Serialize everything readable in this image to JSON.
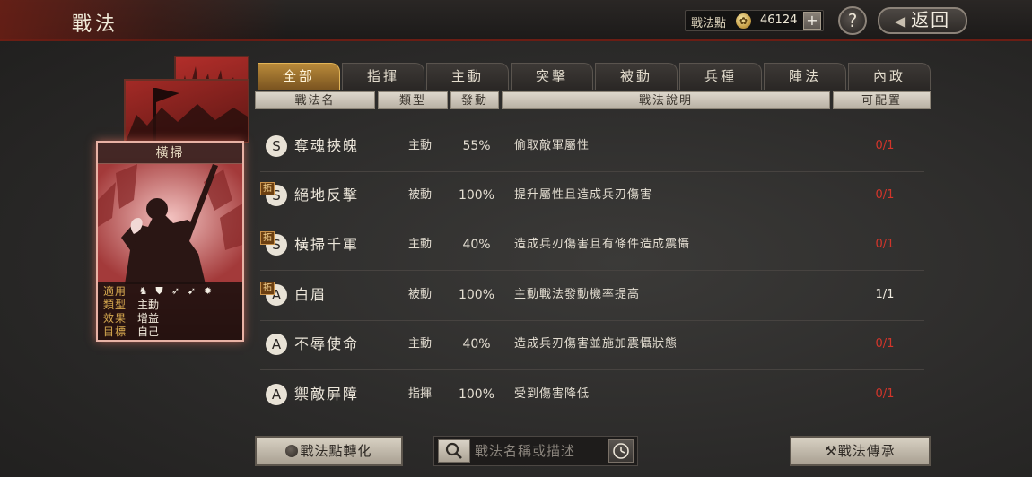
{
  "header": {
    "title": "戰法",
    "points_label": "戰法點",
    "points_value": "46124",
    "plus_label": "+",
    "help_label": "?",
    "back_label": "返回"
  },
  "card": {
    "name": "橫掃",
    "rows": [
      {
        "key": "適用",
        "value": ""
      },
      {
        "key": "類型",
        "value": "主動"
      },
      {
        "key": "效果",
        "value": "增益"
      },
      {
        "key": "目標",
        "value": "自己"
      }
    ],
    "troop_icons": [
      "cavalry-icon",
      "shield-icon",
      "bow-icon",
      "spear-icon",
      "wheel-icon"
    ]
  },
  "tabs": [
    "全部",
    "指揮",
    "主動",
    "突擊",
    "被動",
    "兵種",
    "陣法",
    "內政"
  ],
  "active_tab": 0,
  "columns": [
    "戰法名",
    "類型",
    "發動",
    "戰法說明",
    "可配置"
  ],
  "rows": [
    {
      "grade": "S",
      "tag": "",
      "name": "奪魂挾魄",
      "type": "主動",
      "rate": "55%",
      "desc": "偷取敵軍屬性",
      "slots": "0/1",
      "slot_color": "red"
    },
    {
      "grade": "S",
      "tag": "拓",
      "name": "絕地反擊",
      "type": "被動",
      "rate": "100%",
      "desc": "提升屬性且造成兵刃傷害",
      "slots": "0/1",
      "slot_color": "red"
    },
    {
      "grade": "S",
      "tag": "拓",
      "name": "橫掃千軍",
      "type": "主動",
      "rate": "40%",
      "desc": "造成兵刃傷害且有條件造成震懾",
      "slots": "0/1",
      "slot_color": "red"
    },
    {
      "grade": "A",
      "tag": "拓",
      "name": "白眉",
      "type": "被動",
      "rate": "100%",
      "desc": "主動戰法發動機率提高",
      "slots": "1/1",
      "slot_color": "white"
    },
    {
      "grade": "A",
      "tag": "",
      "name": "不辱使命",
      "type": "主動",
      "rate": "40%",
      "desc": "造成兵刃傷害並施加震懾狀態",
      "slots": "0/1",
      "slot_color": "red"
    },
    {
      "grade": "A",
      "tag": "",
      "name": "禦敵屏障",
      "type": "指揮",
      "rate": "100%",
      "desc": "受到傷害降低",
      "slots": "0/1",
      "slot_color": "red"
    }
  ],
  "footer": {
    "convert_label": "戰法點轉化",
    "search_placeholder": "戰法名稱或描述",
    "inherit_label": "戰法傳承"
  },
  "colors": {
    "accent_gold": "#b98a3a",
    "slot_red": "#d2352a",
    "banner_red": "#6b1d14"
  }
}
